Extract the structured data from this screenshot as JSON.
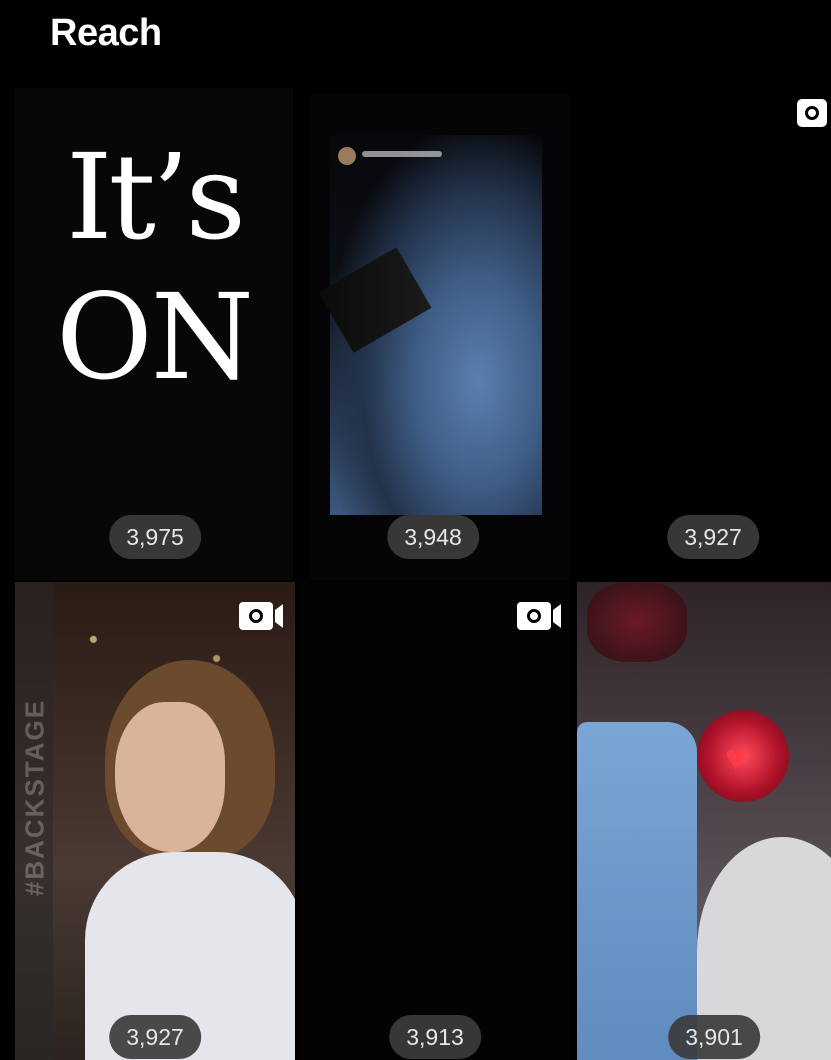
{
  "header": {
    "title": "Reach"
  },
  "tiles": [
    {
      "overlay_text": [
        "It’s",
        "ON"
      ],
      "reach": "3,975",
      "media_type": "none"
    },
    {
      "reach": "3,948",
      "media_type": "none"
    },
    {
      "reach": "3,927",
      "media_type": "photo-icon"
    },
    {
      "side_text": "#BACKSTAGE",
      "reach": "3,927",
      "media_type": "video-icon"
    },
    {
      "reach": "3,913",
      "media_type": "video-icon"
    },
    {
      "reach": "3,901",
      "media_type": "none"
    }
  ],
  "colors": {
    "background": "#000000",
    "badge": "#3c3c3c",
    "text": "#ffffff"
  }
}
